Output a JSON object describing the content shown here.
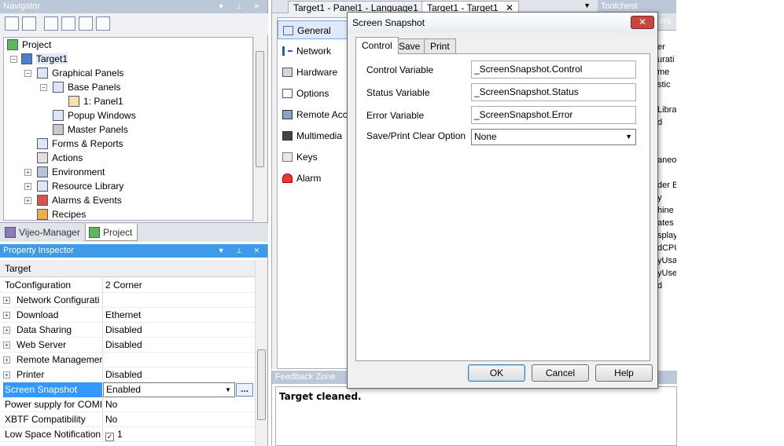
{
  "navigator": {
    "title": "Navigator",
    "tree": [
      {
        "label": "Project"
      },
      {
        "label": "Target1"
      },
      {
        "label": "Graphical Panels"
      },
      {
        "label": "Base Panels"
      },
      {
        "label": "1: Panel1"
      },
      {
        "label": "Popup Windows"
      },
      {
        "label": "Master Panels"
      },
      {
        "label": "Forms & Reports"
      },
      {
        "label": "Actions"
      },
      {
        "label": "Environment"
      },
      {
        "label": "Resource Library"
      },
      {
        "label": "Alarms & Events"
      },
      {
        "label": "Recipes"
      }
    ],
    "tabs": [
      "Vijeo-Manager",
      "Project"
    ]
  },
  "inspector": {
    "title": "Property Inspector",
    "header": "Target",
    "rows": [
      {
        "name": "ToConfiguration",
        "value": "2 Corner"
      },
      {
        "name": "Network Configurati",
        "value": ""
      },
      {
        "name": "Download",
        "value": "Ethernet"
      },
      {
        "name": "Data Sharing",
        "value": "Disabled"
      },
      {
        "name": "Web Server",
        "value": "Disabled"
      },
      {
        "name": "Remote Managemer",
        "value": ""
      },
      {
        "name": "Printer",
        "value": "Disabled"
      },
      {
        "name": "Screen Snapshot",
        "value": "Enabled"
      },
      {
        "name": "Power supply for COMI",
        "value": "No"
      },
      {
        "name": "XBTF Compatibility",
        "value": "No"
      },
      {
        "name": "Low Space Notification",
        "value": "1"
      }
    ],
    "ellipsis": "..."
  },
  "editor": {
    "doc_tabs": [
      "Target1 - Panel1 - Language1",
      "Target1 - Target1"
    ],
    "config_items": [
      "General",
      "Network",
      "Hardware",
      "Options",
      "Remote Acce",
      "Multimedia",
      "Keys",
      "Alarm"
    ]
  },
  "toolchest": {
    "title": "Toolchest",
    "header_fragment": "ers",
    "items": [
      "er",
      "urati",
      "me",
      "stic",
      "Libra",
      "d",
      "aneo",
      "der B",
      "y",
      "hine",
      "ates",
      "splay",
      "dCPU",
      "yUsa",
      "yUse",
      "d"
    ]
  },
  "feedback": {
    "title": "Feedback Zone",
    "message": "Target cleaned."
  },
  "dialog": {
    "title": "Screen Snapshot",
    "tabs": [
      "Control",
      "Save",
      "Print"
    ],
    "fields": [
      {
        "label": "Control Variable",
        "value": "_ScreenSnapshot.Control"
      },
      {
        "label": "Status Variable",
        "value": "_ScreenSnapshot.Status"
      },
      {
        "label": "Error Variable",
        "value": "_ScreenSnapshot.Error"
      }
    ],
    "clear_option": {
      "label": "Save/Print Clear Option",
      "value": "None"
    },
    "buttons": {
      "ok": "OK",
      "cancel": "Cancel",
      "help": "Help"
    }
  }
}
